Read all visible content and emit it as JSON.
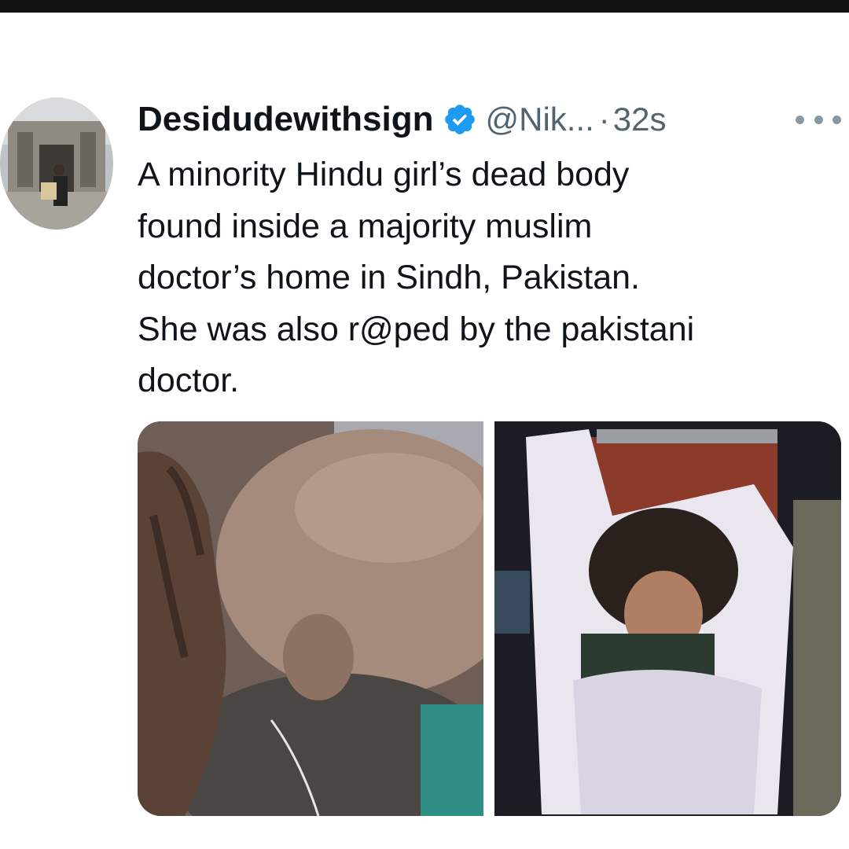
{
  "tweet": {
    "author": {
      "display_name": "Desidudewithsign",
      "handle": "@Nik...",
      "verified": true
    },
    "separator": "·",
    "timestamp": "32s",
    "text": "A minority Hindu girl’s dead body\nfound inside a majority muslim\ndoctor’s home in Sindh, Pakistan.\nShe was also r@ped by the pakistani\ndoctor.",
    "media_count": 2
  },
  "icons": {
    "verified": "verified-badge-icon",
    "more": "more-options-icon"
  },
  "colors": {
    "verified_blue": "#1d9bf0",
    "text_primary": "#0f1419",
    "text_secondary": "#536471"
  }
}
